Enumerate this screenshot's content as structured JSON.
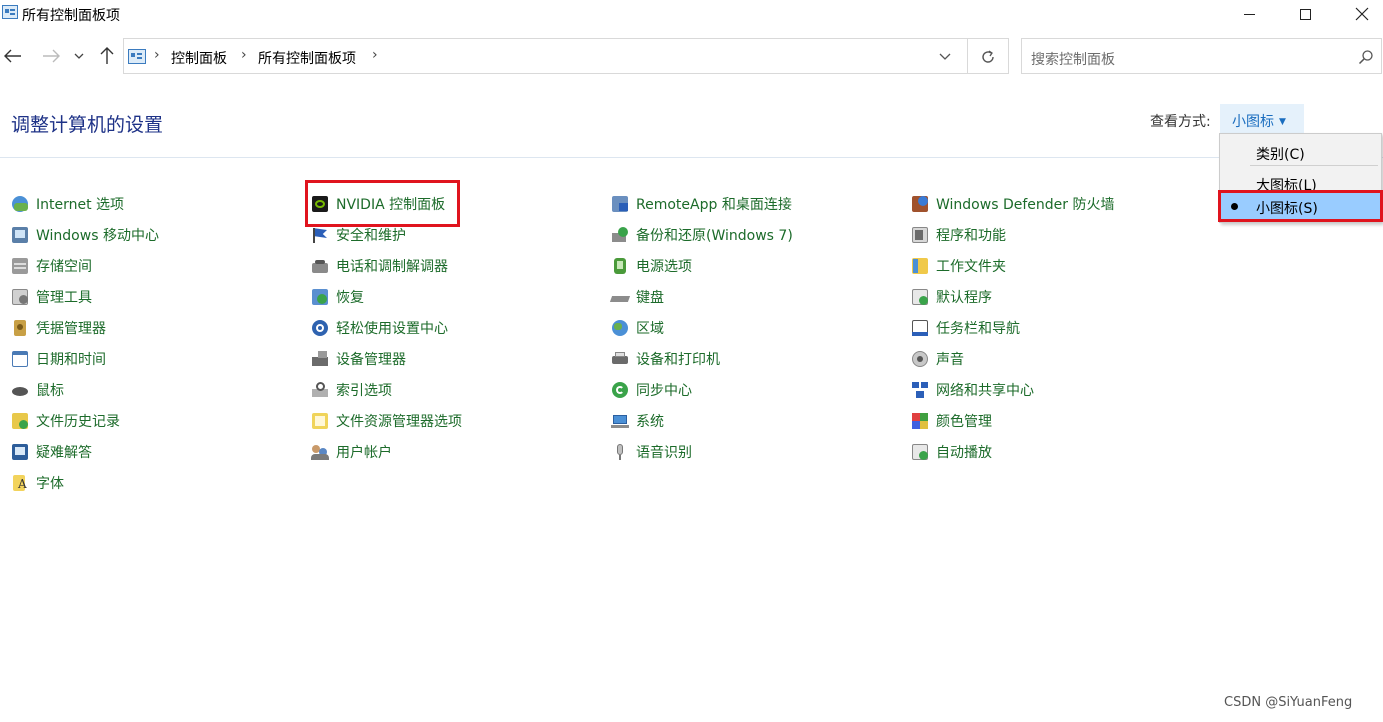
{
  "window": {
    "title": "所有控制面板项"
  },
  "nav": {
    "breadcrumb": [
      "控制面板",
      "所有控制面板项"
    ],
    "search_placeholder": "搜索控制面板"
  },
  "header": {
    "title": "调整计算机的设置",
    "view_label": "查看方式:",
    "view_value": "小图标"
  },
  "view_menu": {
    "items": [
      "类别(C)",
      "大图标(L)",
      "小图标(S)"
    ],
    "selected": "小图标(S)"
  },
  "items": {
    "col1": [
      {
        "label": "Internet 选项",
        "icon": "internet-options-icon"
      },
      {
        "label": "Windows 移动中心",
        "icon": "mobility-center-icon"
      },
      {
        "label": "存储空间",
        "icon": "storage-spaces-icon"
      },
      {
        "label": "管理工具",
        "icon": "admin-tools-icon"
      },
      {
        "label": "凭据管理器",
        "icon": "credential-manager-icon"
      },
      {
        "label": "日期和时间",
        "icon": "date-time-icon"
      },
      {
        "label": "鼠标",
        "icon": "mouse-icon"
      },
      {
        "label": "文件历史记录",
        "icon": "file-history-icon"
      },
      {
        "label": "疑难解答",
        "icon": "troubleshooting-icon"
      },
      {
        "label": "字体",
        "icon": "fonts-icon"
      }
    ],
    "col2": [
      {
        "label": "NVIDIA 控制面板",
        "icon": "nvidia-icon"
      },
      {
        "label": "安全和维护",
        "icon": "security-flag-icon"
      },
      {
        "label": "电话和调制解调器",
        "icon": "phone-modem-icon"
      },
      {
        "label": "恢复",
        "icon": "recovery-icon"
      },
      {
        "label": "轻松使用设置中心",
        "icon": "ease-of-access-icon"
      },
      {
        "label": "设备管理器",
        "icon": "device-manager-icon"
      },
      {
        "label": "索引选项",
        "icon": "indexing-icon"
      },
      {
        "label": "文件资源管理器选项",
        "icon": "folder-options-icon"
      },
      {
        "label": "用户帐户",
        "icon": "user-accounts-icon"
      }
    ],
    "col3": [
      {
        "label": "RemoteApp 和桌面连接",
        "icon": "remoteapp-icon"
      },
      {
        "label": "备份和还原(Windows 7)",
        "icon": "backup-restore-icon"
      },
      {
        "label": "电源选项",
        "icon": "power-options-icon"
      },
      {
        "label": "键盘",
        "icon": "keyboard-icon"
      },
      {
        "label": "区域",
        "icon": "region-icon"
      },
      {
        "label": "设备和打印机",
        "icon": "printer-icon"
      },
      {
        "label": "同步中心",
        "icon": "sync-center-icon"
      },
      {
        "label": "系统",
        "icon": "system-icon"
      },
      {
        "label": "语音识别",
        "icon": "microphone-icon"
      }
    ],
    "col4": [
      {
        "label": "Windows Defender 防火墙",
        "icon": "firewall-icon"
      },
      {
        "label": "程序和功能",
        "icon": "programs-icon"
      },
      {
        "label": "工作文件夹",
        "icon": "work-folders-icon"
      },
      {
        "label": "默认程序",
        "icon": "default-programs-icon"
      },
      {
        "label": "任务栏和导航",
        "icon": "taskbar-icon"
      },
      {
        "label": "声音",
        "icon": "sound-icon"
      },
      {
        "label": "网络和共享中心",
        "icon": "network-icon"
      },
      {
        "label": "颜色管理",
        "icon": "color-management-icon"
      },
      {
        "label": "自动播放",
        "icon": "autoplay-icon"
      }
    ]
  },
  "watermark": "CSDN @SiYuanFeng",
  "colors": {
    "link_green": "#1c6b2a",
    "title_blue": "#1e3287",
    "highlight_red": "#e0141e",
    "menu_selected": "#99ccff"
  }
}
